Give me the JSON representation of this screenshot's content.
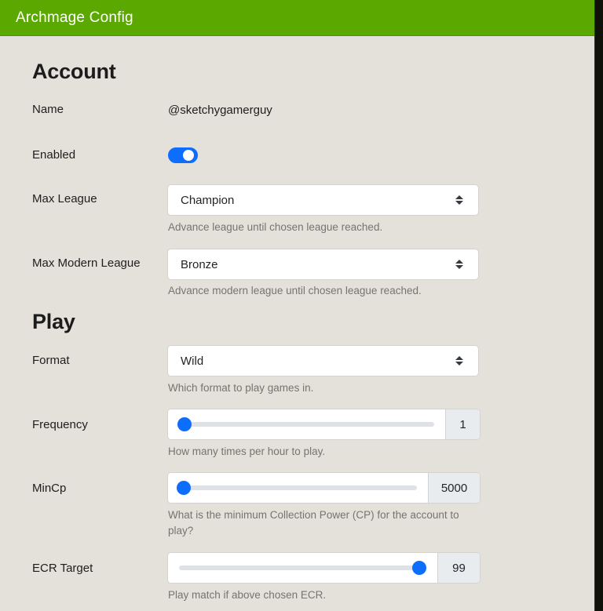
{
  "window": {
    "title": "Archmage Config",
    "header_color": "#5aa800",
    "background_color": "#e4e0da",
    "accent_color": "#0d6efd"
  },
  "sections": [
    {
      "id": "account",
      "title": "Account",
      "rows": [
        {
          "label": "Name",
          "type": "text",
          "value": "@sketchygamerguy",
          "help": ""
        },
        {
          "label": "Enabled",
          "type": "toggle",
          "value": "on",
          "help": ""
        },
        {
          "label": "Max League",
          "type": "select",
          "value": "Champion",
          "help": "Advance league until chosen league reached."
        },
        {
          "label": "Max Modern League",
          "type": "select",
          "value": "Bronze",
          "help": "Advance modern league until chosen league reached."
        }
      ]
    },
    {
      "id": "play",
      "title": "Play",
      "rows": [
        {
          "label": "Format",
          "type": "select",
          "value": "Wild",
          "help": "Which format to play games in."
        },
        {
          "label": "Frequency",
          "type": "slider",
          "value": "1",
          "percent": 2,
          "help": "How many times per hour to play."
        },
        {
          "label": "MinCp",
          "type": "slider",
          "value": "5000",
          "percent": 2,
          "help": "What is the minimum Collection Power (CP) for the account to play?"
        },
        {
          "label": "ECR Target",
          "type": "slider",
          "value": "99",
          "percent": 97,
          "help": "Play match if above chosen ECR."
        }
      ]
    }
  ]
}
